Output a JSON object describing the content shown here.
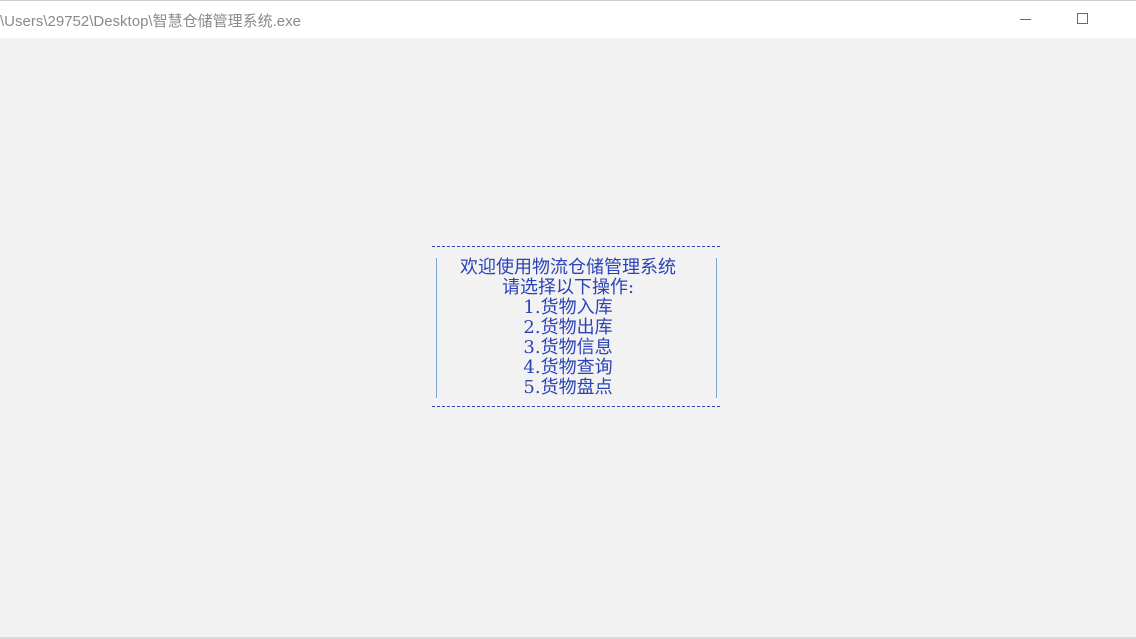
{
  "window": {
    "title": "\\Users\\29752\\Desktop\\智慧仓储管理系统.exe",
    "minimize_icon": "minimize-icon",
    "maximize_icon": "maximize-icon"
  },
  "console": {
    "top_rule": "_____________________________",
    "welcome": "欢迎使用物流仓储管理系统",
    "prompt": "请选择以下操作:",
    "options": [
      "1.货物入库",
      "2.货物出库",
      "3.货物信息",
      "4.货物查询",
      "5.货物盘点"
    ],
    "bottom_rule": "_____________________________"
  }
}
